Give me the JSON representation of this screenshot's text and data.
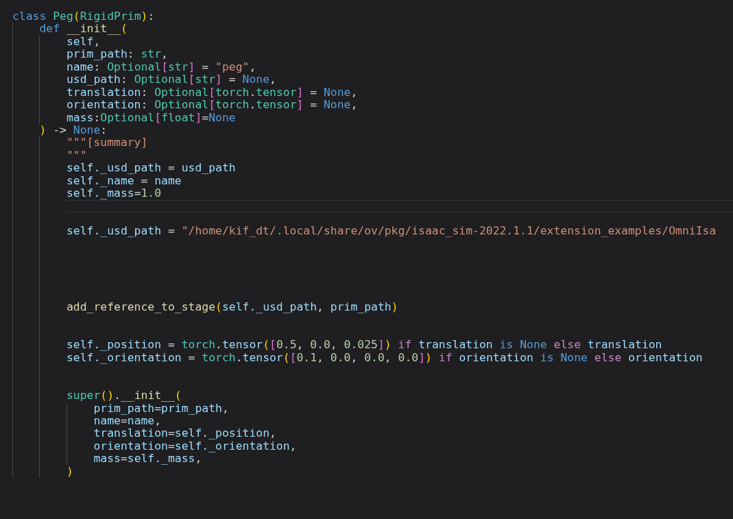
{
  "editor": {
    "lines": [
      {
        "kind": "code",
        "tokens": [
          {
            "text": "class ",
            "kind": "keyword"
          },
          {
            "text": "Peg",
            "kind": "type"
          },
          {
            "text": "(",
            "kind": "bracket1"
          },
          {
            "text": "RigidPrim",
            "kind": "type"
          },
          {
            "text": ")",
            "kind": "bracket1"
          },
          {
            "text": ":",
            "kind": "plain"
          }
        ],
        "children": [
          {
            "kind": "code",
            "tokens": [
              {
                "text": "def ",
                "kind": "keyword"
              },
              {
                "text": "__init__",
                "kind": "function"
              },
              {
                "text": "(",
                "kind": "bracket1"
              }
            ],
            "children": [
              {
                "kind": "code",
                "tokens": [
                  {
                    "text": "self",
                    "kind": "var"
                  },
                  {
                    "text": ",",
                    "kind": "plain"
                  }
                ]
              },
              {
                "kind": "code",
                "tokens": [
                  {
                    "text": "prim_path",
                    "kind": "var"
                  },
                  {
                    "text": ": ",
                    "kind": "plain"
                  },
                  {
                    "text": "str",
                    "kind": "type"
                  },
                  {
                    "text": ",",
                    "kind": "plain"
                  }
                ]
              },
              {
                "kind": "code",
                "tokens": [
                  {
                    "text": "name",
                    "kind": "var"
                  },
                  {
                    "text": ": ",
                    "kind": "plain"
                  },
                  {
                    "text": "Optional",
                    "kind": "type"
                  },
                  {
                    "text": "[",
                    "kind": "bracket2"
                  },
                  {
                    "text": "str",
                    "kind": "type"
                  },
                  {
                    "text": "]",
                    "kind": "bracket2"
                  },
                  {
                    "text": " = ",
                    "kind": "plain"
                  },
                  {
                    "text": "\"peg\"",
                    "kind": "string"
                  },
                  {
                    "text": ",",
                    "kind": "plain"
                  }
                ]
              },
              {
                "kind": "code",
                "tokens": [
                  {
                    "text": "usd_path",
                    "kind": "var"
                  },
                  {
                    "text": ": ",
                    "kind": "plain"
                  },
                  {
                    "text": "Optional",
                    "kind": "type"
                  },
                  {
                    "text": "[",
                    "kind": "bracket2"
                  },
                  {
                    "text": "str",
                    "kind": "type"
                  },
                  {
                    "text": "]",
                    "kind": "bracket2"
                  },
                  {
                    "text": " = ",
                    "kind": "plain"
                  },
                  {
                    "text": "None",
                    "kind": "constant"
                  },
                  {
                    "text": ",",
                    "kind": "plain"
                  }
                ]
              },
              {
                "kind": "code",
                "tokens": [
                  {
                    "text": "translation",
                    "kind": "var"
                  },
                  {
                    "text": ": ",
                    "kind": "plain"
                  },
                  {
                    "text": "Optional",
                    "kind": "type"
                  },
                  {
                    "text": "[",
                    "kind": "bracket2"
                  },
                  {
                    "text": "torch",
                    "kind": "type"
                  },
                  {
                    "text": ".",
                    "kind": "plain"
                  },
                  {
                    "text": "tensor",
                    "kind": "type"
                  },
                  {
                    "text": "]",
                    "kind": "bracket2"
                  },
                  {
                    "text": " = ",
                    "kind": "plain"
                  },
                  {
                    "text": "None",
                    "kind": "constant"
                  },
                  {
                    "text": ",",
                    "kind": "plain"
                  }
                ]
              },
              {
                "kind": "code",
                "tokens": [
                  {
                    "text": "orientation",
                    "kind": "var"
                  },
                  {
                    "text": ": ",
                    "kind": "plain"
                  },
                  {
                    "text": "Optional",
                    "kind": "type"
                  },
                  {
                    "text": "[",
                    "kind": "bracket2"
                  },
                  {
                    "text": "torch",
                    "kind": "type"
                  },
                  {
                    "text": ".",
                    "kind": "plain"
                  },
                  {
                    "text": "tensor",
                    "kind": "type"
                  },
                  {
                    "text": "]",
                    "kind": "bracket2"
                  },
                  {
                    "text": " = ",
                    "kind": "plain"
                  },
                  {
                    "text": "None",
                    "kind": "constant"
                  },
                  {
                    "text": ",",
                    "kind": "plain"
                  }
                ]
              },
              {
                "kind": "code",
                "tokens": [
                  {
                    "text": "mass",
                    "kind": "var"
                  },
                  {
                    "text": ":",
                    "kind": "plain"
                  },
                  {
                    "text": "Optional",
                    "kind": "type"
                  },
                  {
                    "text": "[",
                    "kind": "bracket2"
                  },
                  {
                    "text": "float",
                    "kind": "type"
                  },
                  {
                    "text": "]",
                    "kind": "bracket2"
                  },
                  {
                    "text": "=",
                    "kind": "plain"
                  },
                  {
                    "text": "None",
                    "kind": "constant"
                  }
                ]
              }
            ]
          },
          {
            "kind": "code",
            "tokens": [
              {
                "text": ")",
                "kind": "bracket1"
              },
              {
                "text": " -> ",
                "kind": "plain"
              },
              {
                "text": "None",
                "kind": "constant"
              },
              {
                "text": ":",
                "kind": "plain"
              }
            ],
            "children": [
              {
                "kind": "code",
                "tokens": [
                  {
                    "text": "\"\"\"[summary]",
                    "kind": "string"
                  }
                ]
              },
              {
                "kind": "code",
                "tokens": [
                  {
                    "text": "\"\"\"",
                    "kind": "string"
                  }
                ]
              },
              {
                "kind": "code",
                "tokens": [
                  {
                    "text": "self._usd_path",
                    "kind": "var"
                  },
                  {
                    "text": " = ",
                    "kind": "plain"
                  },
                  {
                    "text": "usd_path",
                    "kind": "var"
                  }
                ]
              },
              {
                "kind": "code",
                "tokens": [
                  {
                    "text": "self._name",
                    "kind": "var"
                  },
                  {
                    "text": " = ",
                    "kind": "plain"
                  },
                  {
                    "text": "name",
                    "kind": "var"
                  }
                ]
              },
              {
                "kind": "code",
                "tokens": [
                  {
                    "text": "self._mass",
                    "kind": "var"
                  },
                  {
                    "text": "=",
                    "kind": "plain"
                  },
                  {
                    "text": "1.0",
                    "kind": "number"
                  }
                ]
              },
              {
                "kind": "cursor"
              },
              {
                "kind": "blank"
              },
              {
                "kind": "code",
                "tokens": [
                  {
                    "text": "self._usd_path",
                    "kind": "var"
                  },
                  {
                    "text": " = ",
                    "kind": "plain"
                  },
                  {
                    "text": "\"/home/kif_dt/.local/share/ov/pkg/isaac_sim-2022.1.1/extension_examples/OmniIsa",
                    "kind": "string"
                  }
                ]
              },
              {
                "kind": "blank"
              },
              {
                "kind": "blank"
              },
              {
                "kind": "blank"
              },
              {
                "kind": "blank"
              },
              {
                "kind": "blank"
              },
              {
                "kind": "code",
                "tokens": [
                  {
                    "text": "add_reference_to_stage",
                    "kind": "function"
                  },
                  {
                    "text": "(",
                    "kind": "bracket1"
                  },
                  {
                    "text": "self._usd_path",
                    "kind": "var"
                  },
                  {
                    "text": ", ",
                    "kind": "plain"
                  },
                  {
                    "text": "prim_path",
                    "kind": "var"
                  },
                  {
                    "text": ")",
                    "kind": "bracket1"
                  }
                ]
              },
              {
                "kind": "blank"
              },
              {
                "kind": "blank"
              },
              {
                "kind": "code",
                "tokens": [
                  {
                    "text": "self._position",
                    "kind": "var"
                  },
                  {
                    "text": " = ",
                    "kind": "plain"
                  },
                  {
                    "text": "torch",
                    "kind": "type"
                  },
                  {
                    "text": ".",
                    "kind": "plain"
                  },
                  {
                    "text": "tensor",
                    "kind": "var"
                  },
                  {
                    "text": "(",
                    "kind": "bracket1"
                  },
                  {
                    "text": "[",
                    "kind": "bracket2"
                  },
                  {
                    "text": "0.5",
                    "kind": "number"
                  },
                  {
                    "text": ", ",
                    "kind": "plain"
                  },
                  {
                    "text": "0.0",
                    "kind": "number"
                  },
                  {
                    "text": ", ",
                    "kind": "plain"
                  },
                  {
                    "text": "0.025",
                    "kind": "number"
                  },
                  {
                    "text": "]",
                    "kind": "bracket2"
                  },
                  {
                    "text": ")",
                    "kind": "bracket1"
                  },
                  {
                    "text": " if ",
                    "kind": "control"
                  },
                  {
                    "text": "translation",
                    "kind": "var"
                  },
                  {
                    "text": " is ",
                    "kind": "keyword"
                  },
                  {
                    "text": "None",
                    "kind": "constant"
                  },
                  {
                    "text": " else ",
                    "kind": "control"
                  },
                  {
                    "text": "translation",
                    "kind": "var"
                  }
                ]
              },
              {
                "kind": "code",
                "tokens": [
                  {
                    "text": "self._orientation",
                    "kind": "var"
                  },
                  {
                    "text": " = ",
                    "kind": "plain"
                  },
                  {
                    "text": "torch",
                    "kind": "type"
                  },
                  {
                    "text": ".",
                    "kind": "plain"
                  },
                  {
                    "text": "tensor",
                    "kind": "var"
                  },
                  {
                    "text": "(",
                    "kind": "bracket1"
                  },
                  {
                    "text": "[",
                    "kind": "bracket2"
                  },
                  {
                    "text": "0.1",
                    "kind": "number"
                  },
                  {
                    "text": ", ",
                    "kind": "plain"
                  },
                  {
                    "text": "0.0",
                    "kind": "number"
                  },
                  {
                    "text": ", ",
                    "kind": "plain"
                  },
                  {
                    "text": "0.0",
                    "kind": "number"
                  },
                  {
                    "text": ", ",
                    "kind": "plain"
                  },
                  {
                    "text": "0.0",
                    "kind": "number"
                  },
                  {
                    "text": "]",
                    "kind": "bracket2"
                  },
                  {
                    "text": ")",
                    "kind": "bracket1"
                  },
                  {
                    "text": " if ",
                    "kind": "control"
                  },
                  {
                    "text": "orientation",
                    "kind": "var"
                  },
                  {
                    "text": " is ",
                    "kind": "keyword"
                  },
                  {
                    "text": "None",
                    "kind": "constant"
                  },
                  {
                    "text": " else ",
                    "kind": "control"
                  },
                  {
                    "text": "orientation",
                    "kind": "var"
                  }
                ]
              },
              {
                "kind": "blank"
              },
              {
                "kind": "blank"
              },
              {
                "kind": "code",
                "tokens": [
                  {
                    "text": "super",
                    "kind": "type"
                  },
                  {
                    "text": "()",
                    "kind": "bracket1"
                  },
                  {
                    "text": ".",
                    "kind": "plain"
                  },
                  {
                    "text": "__init__",
                    "kind": "function"
                  },
                  {
                    "text": "(",
                    "kind": "bracket1"
                  }
                ],
                "children": [
                  {
                    "kind": "code",
                    "tokens": [
                      {
                        "text": "prim_path",
                        "kind": "var"
                      },
                      {
                        "text": "=",
                        "kind": "plain"
                      },
                      {
                        "text": "prim_path",
                        "kind": "var"
                      },
                      {
                        "text": ",",
                        "kind": "plain"
                      }
                    ]
                  },
                  {
                    "kind": "code",
                    "tokens": [
                      {
                        "text": "name",
                        "kind": "var"
                      },
                      {
                        "text": "=",
                        "kind": "plain"
                      },
                      {
                        "text": "name",
                        "kind": "var"
                      },
                      {
                        "text": ",",
                        "kind": "plain"
                      }
                    ]
                  },
                  {
                    "kind": "code",
                    "tokens": [
                      {
                        "text": "translation",
                        "kind": "var"
                      },
                      {
                        "text": "=",
                        "kind": "plain"
                      },
                      {
                        "text": "self._position",
                        "kind": "var"
                      },
                      {
                        "text": ",",
                        "kind": "plain"
                      }
                    ]
                  },
                  {
                    "kind": "code",
                    "tokens": [
                      {
                        "text": "orientation",
                        "kind": "var"
                      },
                      {
                        "text": "=",
                        "kind": "plain"
                      },
                      {
                        "text": "self._orientation",
                        "kind": "var"
                      },
                      {
                        "text": ",",
                        "kind": "plain"
                      }
                    ]
                  },
                  {
                    "kind": "code",
                    "tokens": [
                      {
                        "text": "mass",
                        "kind": "var"
                      },
                      {
                        "text": "=",
                        "kind": "plain"
                      },
                      {
                        "text": "self._mass",
                        "kind": "var"
                      },
                      {
                        "text": ",",
                        "kind": "plain"
                      }
                    ]
                  }
                ]
              },
              {
                "kind": "code",
                "tokens": [
                  {
                    "text": ")",
                    "kind": "bracket1"
                  }
                ]
              }
            ]
          }
        ]
      }
    ]
  }
}
